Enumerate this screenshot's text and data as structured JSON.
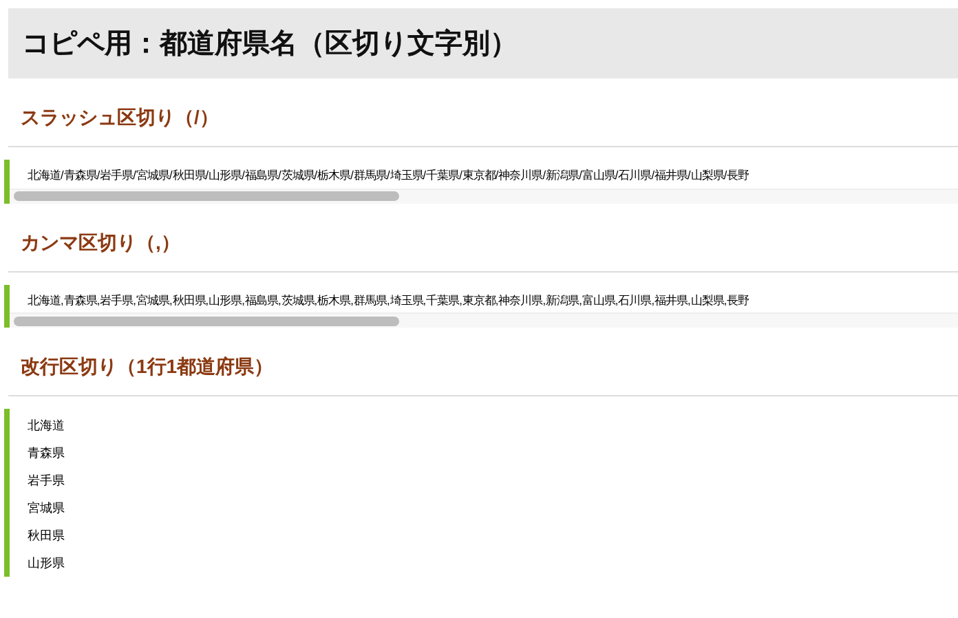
{
  "title": "コピペ用：都道府県名（区切り文字別）",
  "sections": [
    {
      "kind": "inline",
      "heading": "スラッシュ区切り（/）",
      "text": "北海道/青森県/岩手県/宮城県/秋田県/山形県/福島県/茨城県/栃木県/群馬県/埼玉県/千葉県/東京都/神奈川県/新潟県/富山県/石川県/福井県/山梨県/長野"
    },
    {
      "kind": "inline",
      "heading": "カンマ区切り（,）",
      "text": "北海道,青森県,岩手県,宮城県,秋田県,山形県,福島県,茨城県,栃木県,群馬県,埼玉県,千葉県,東京都,神奈川県,新潟県,富山県,石川県,福井県,山梨県,長野"
    },
    {
      "kind": "lines",
      "heading": "改行区切り（1行1都道府県）",
      "lines": [
        "北海道",
        "青森県",
        "岩手県",
        "宮城県",
        "秋田県",
        "山形県"
      ]
    }
  ]
}
